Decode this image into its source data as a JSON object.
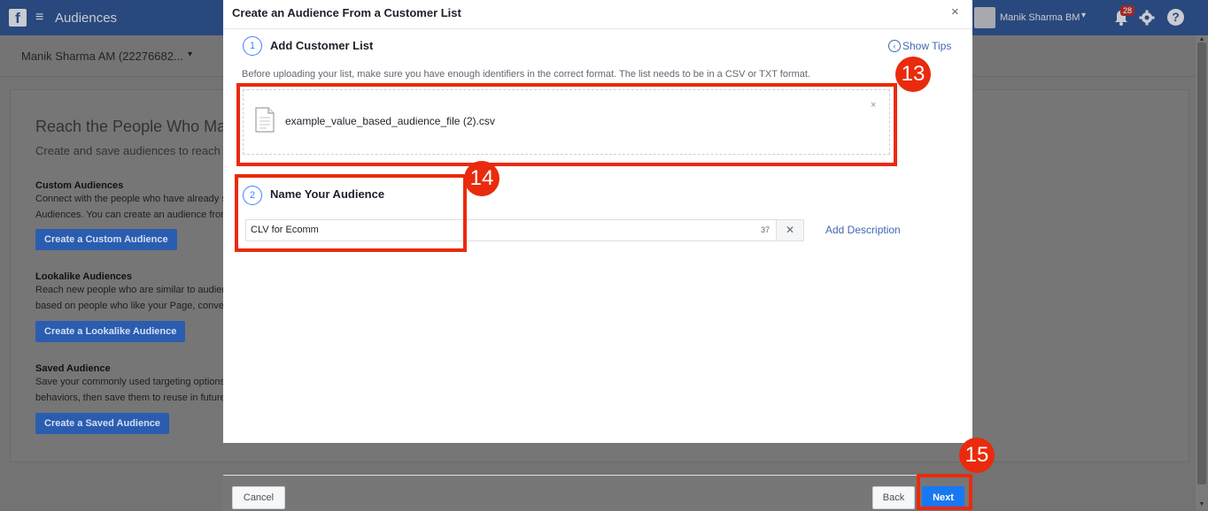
{
  "topbar": {
    "logo": "f",
    "menu_icon": "≡",
    "title": "Audiences",
    "user_name": "Manik Sharma BM",
    "user_caret": "▾",
    "notif_count": "28",
    "help_icon": "?"
  },
  "account": {
    "name": "Manik Sharma AM (22276682...",
    "caret": "▾"
  },
  "background": {
    "heading": "Reach the People Who Ma",
    "subheading": "Create and save audiences to reach th",
    "custom": {
      "title": "Custom Audiences",
      "line1": "Connect with the people who have already s",
      "line2": "Audiences. You can create an audience from",
      "button": "Create a Custom Audience"
    },
    "lookalike": {
      "title": "Lookalike Audiences",
      "line1": "Reach new people who are similar to audien",
      "line2": "based on people who like your Page, conver",
      "button": "Create a Lookalike Audience"
    },
    "saved": {
      "title": "Saved Audience",
      "line1": "Save your commonly used targeting options",
      "line2": "behaviors, then save them to reuse in future",
      "button": "Create a Saved Audience"
    }
  },
  "modal": {
    "title": "Create an Audience From a Customer List",
    "close": "×",
    "show_tips_icon": "‹",
    "show_tips": "Show Tips",
    "step1": {
      "number": "1",
      "title": "Add Customer List",
      "description": "Before uploading your list, make sure you have enough identifiers in the correct format. The list needs to be in a CSV or TXT format.",
      "file_name": "example_value_based_audience_file (2).csv",
      "remove": "×"
    },
    "step2": {
      "number": "2",
      "title": "Name Your Audience",
      "audience_name": "CLV for Ecomm",
      "char_count": "37",
      "clear": "✕",
      "add_description": "Add Description"
    }
  },
  "footer": {
    "cancel": "Cancel",
    "back": "Back",
    "next": "Next"
  },
  "annotations": {
    "badge_13": "13",
    "badge_14": "14",
    "badge_15": "15"
  },
  "scrollbar": {
    "up": "▲",
    "down": "▼"
  }
}
